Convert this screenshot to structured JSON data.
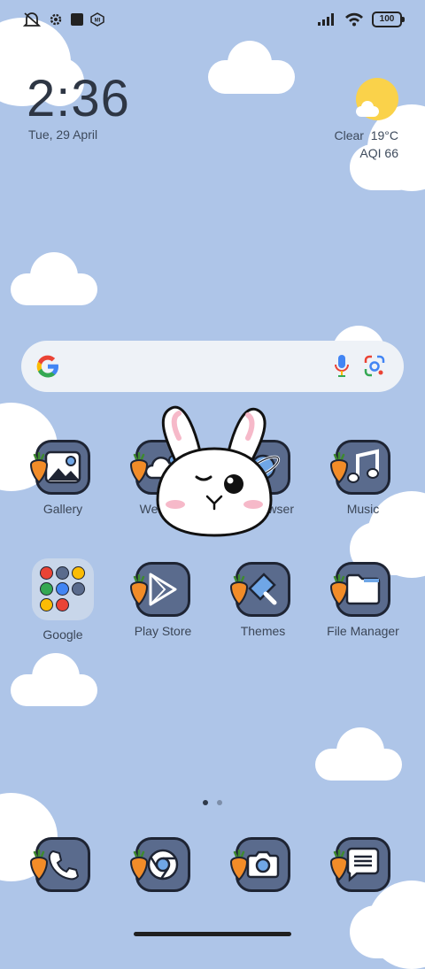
{
  "status_bar": {
    "left_icons": [
      "vibrate-off-icon",
      "settings-icon",
      "square-icon",
      "mi-icon"
    ],
    "right_icons": [
      "signal-icon",
      "wifi-icon",
      "battery-icon"
    ],
    "battery": "100"
  },
  "clock": {
    "time": "2:36",
    "date": "Tue, 29 April"
  },
  "weather": {
    "condition": "Clear",
    "temperature": "19°C",
    "aqi": "AQI 66"
  },
  "search_bar": {
    "icons": [
      "google-g-icon",
      "microphone-icon",
      "google-lens-icon"
    ]
  },
  "apps_row1": [
    {
      "label": "Gallery",
      "icon": "gallery-icon"
    },
    {
      "label": "Weather",
      "icon": "weather-icon"
    },
    {
      "label": "Mi Browser",
      "icon": "browser-icon"
    },
    {
      "label": "Music",
      "icon": "music-icon"
    }
  ],
  "apps_row2": [
    {
      "label": "Google",
      "icon": "folder-icon"
    },
    {
      "label": "Play Store",
      "icon": "play-store-icon"
    },
    {
      "label": "Themes",
      "icon": "themes-icon"
    },
    {
      "label": "File Manager",
      "icon": "file-manager-icon"
    }
  ],
  "dock": [
    {
      "icon": "phone-icon"
    },
    {
      "icon": "chrome-icon"
    },
    {
      "icon": "camera-icon"
    },
    {
      "icon": "messages-icon"
    }
  ],
  "page_indicator": {
    "pages": 2,
    "current": 1
  },
  "colors": {
    "background": "#aec5e8",
    "tile": "#5a6b8d",
    "carrot": "#f28c28"
  }
}
